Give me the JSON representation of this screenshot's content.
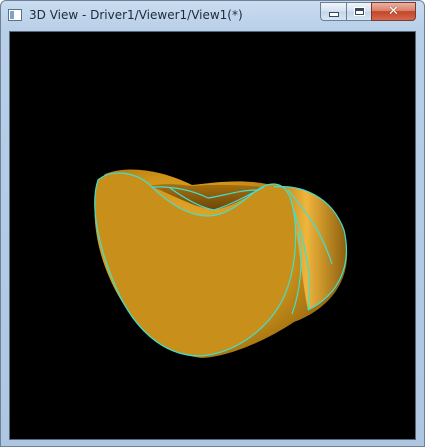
{
  "window": {
    "title": "3D View - Driver1/Viewer1/View1(*)"
  },
  "titlebar": {
    "icon": "window-icon",
    "buttons": [
      {
        "name": "minimize",
        "icon": "minimize-icon"
      },
      {
        "name": "maximize",
        "icon": "maximize-icon"
      },
      {
        "name": "close",
        "icon": "close-icon"
      }
    ]
  },
  "viewport": {
    "background_color": "#000000",
    "shape_face_color": "#C8901A",
    "shape_edge_color": "#3FE0D0"
  }
}
